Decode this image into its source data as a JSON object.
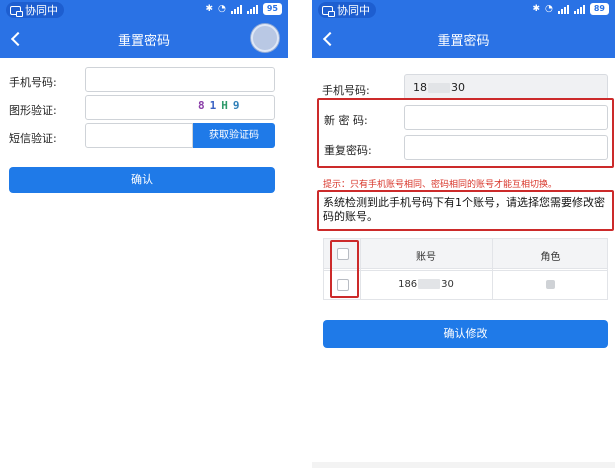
{
  "left": {
    "status": {
      "app_pill": "协同中",
      "battery": "95"
    },
    "title": "重置密码",
    "phone_label": "手机号码:",
    "captcha_label": "图形验证:",
    "captcha_chars": [
      {
        "ch": "8",
        "color": "#8a3ea8"
      },
      {
        "ch": "1",
        "color": "#3a62c4"
      },
      {
        "ch": "H",
        "color": "#2f9a6a"
      },
      {
        "ch": "9",
        "color": "#2f7fb8"
      }
    ],
    "sms_label": "短信验证:",
    "sms_button": "获取验证码",
    "confirm_button": "确认"
  },
  "right": {
    "status": {
      "app_pill": "协同中",
      "battery": "89"
    },
    "title": "重置密码",
    "phone_label": "手机号码:",
    "phone_prefix": "18",
    "phone_suffix": "30",
    "new_pwd_label": "新 密 码:",
    "repeat_pwd_label": "重复密码:",
    "hint": "提示：只有手机账号相同、密码相同的账号才能互相切换。",
    "notice": "系统检测到此手机号码下有1个账号，请选择您需要修改密码的账号。",
    "table": {
      "col_account": "账号",
      "col_role": "角色",
      "row_account_prefix": "186",
      "row_account_suffix": "30"
    },
    "confirm_button": "确认修改"
  },
  "colors": {
    "brand": "#2a72e5",
    "button": "#1f7ae8",
    "highlight": "#cc2a2a",
    "hint": "#d8352a"
  }
}
